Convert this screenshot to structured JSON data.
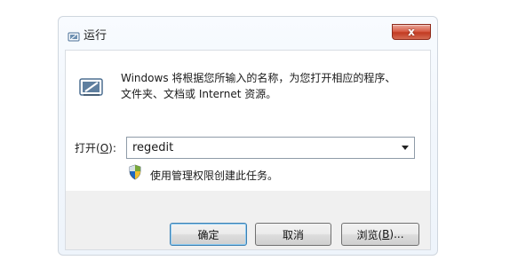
{
  "window": {
    "title": "运行",
    "close_symbol": "x"
  },
  "description": {
    "line1": "Windows 将根据您所输入的名称，为您打开相应的程序、",
    "line2": "文件夹、文档或 Internet 资源。"
  },
  "open": {
    "label_prefix": "打开(",
    "label_hotkey": "O",
    "label_suffix": "):",
    "value": "regedit"
  },
  "admin_note": "使用管理权限创建此任务。",
  "buttons": {
    "ok": "确定",
    "cancel": "取消",
    "browse_prefix": "浏览(",
    "browse_hotkey": "B",
    "browse_suffix": ")..."
  },
  "icons": {
    "title": "run-dialog-icon",
    "content": "run-program-icon",
    "shield": "uac-shield-icon",
    "dropdown": "chevron-down-icon"
  },
  "colors": {
    "close_red": "#c23b22",
    "default_button_blue": "#3c7fb1"
  }
}
